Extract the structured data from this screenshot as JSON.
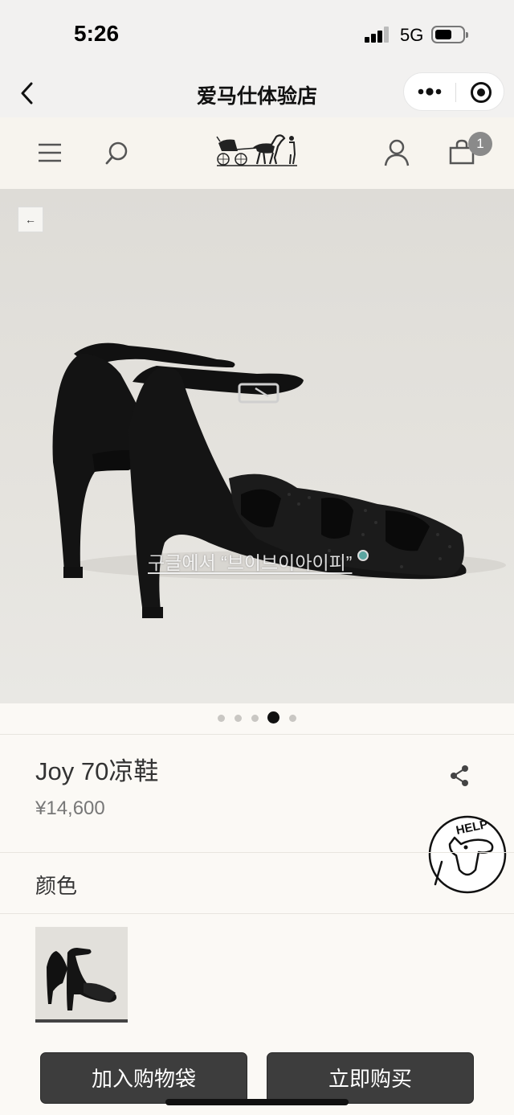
{
  "status_bar": {
    "time": "5:26",
    "network": "5G",
    "icons": [
      "signal-bars-icon",
      "battery-icon"
    ]
  },
  "mini_program": {
    "title": "爱马仕体验店",
    "icons": [
      "back-chevron-icon",
      "more-dots-icon",
      "close-target-icon"
    ]
  },
  "header": {
    "icons": [
      "menu-icon",
      "search-icon",
      "hermes-carriage-logo",
      "account-icon",
      "shopping-bag-icon"
    ],
    "cart_count": "1"
  },
  "gallery": {
    "back_arrow": "←",
    "overlay_text": "구글에서 “브이브이아이피”",
    "page_count": 5,
    "active_page": 4
  },
  "product": {
    "name": "Joy 70凉鞋",
    "price": "¥14,600",
    "share_icon": "share-icon"
  },
  "help_badge": {
    "text": "HELP"
  },
  "color_section": {
    "label": "颜色"
  },
  "actions": {
    "add_to_bag": "加入购物袋",
    "buy_now": "立即购买"
  },
  "colors": {
    "status_bg": "#f2f1f0",
    "header_bg": "#f7f4ee",
    "page_bg": "#fbf9f5",
    "button_bg": "#3d3d3d",
    "badge_bg": "#8a8a8a"
  }
}
